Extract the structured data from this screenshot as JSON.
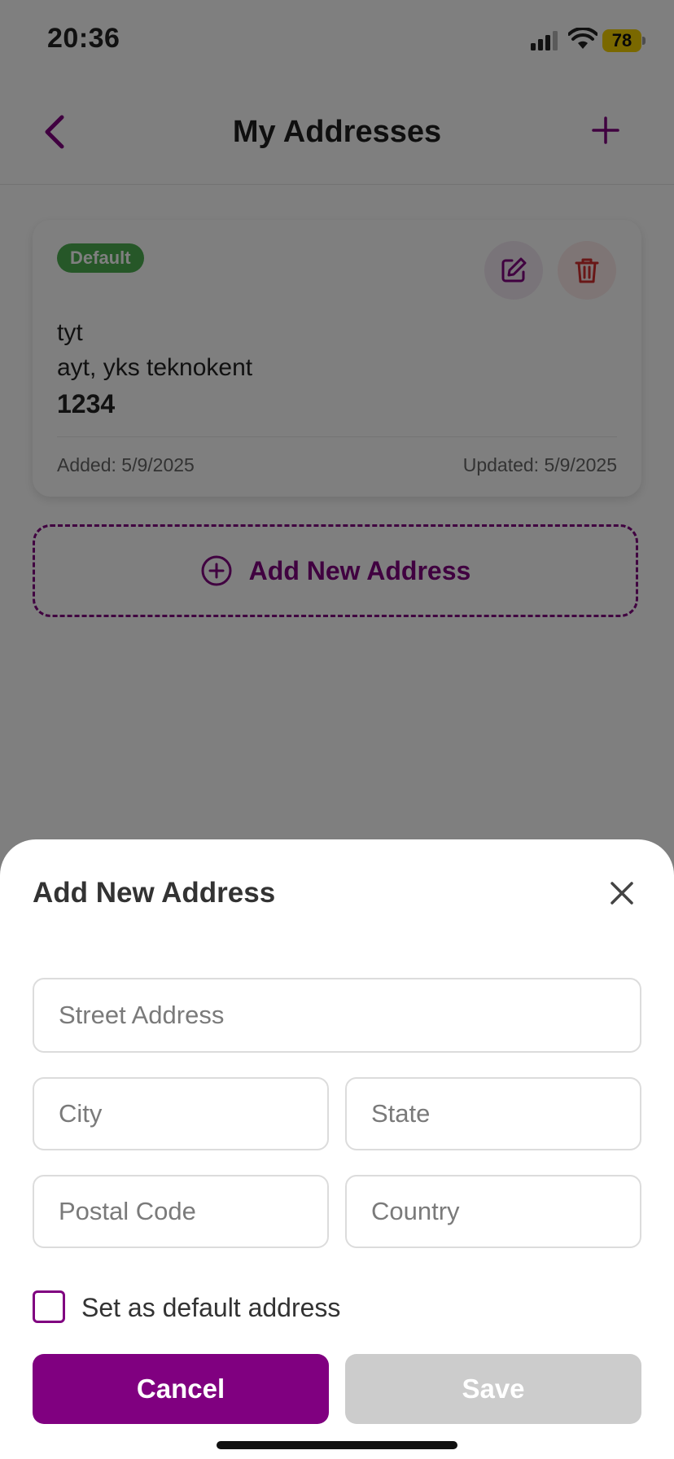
{
  "status_bar": {
    "time": "20:36",
    "battery": "78"
  },
  "header": {
    "title": "My Addresses",
    "back_icon": "chevron-left-icon",
    "add_icon": "plus-icon"
  },
  "address_card": {
    "badge": "Default",
    "line1": "tyt",
    "line2": "ayt, yks teknokent",
    "line3": "1234",
    "added": "Added: 5/9/2025",
    "updated": "Updated: 5/9/2025"
  },
  "add_new_button": {
    "label": "Add New Address"
  },
  "sheet": {
    "title": "Add New Address",
    "fields": {
      "street_placeholder": "Street Address",
      "city_placeholder": "City",
      "state_placeholder": "State",
      "postal_placeholder": "Postal Code",
      "country_placeholder": "Country"
    },
    "default_checkbox_label": "Set as default address",
    "cancel_label": "Cancel",
    "save_label": "Save"
  },
  "colors": {
    "accent": "#800080",
    "badge": "#4caf50",
    "delete": "#d32f2f",
    "disabled": "#cccccc"
  }
}
